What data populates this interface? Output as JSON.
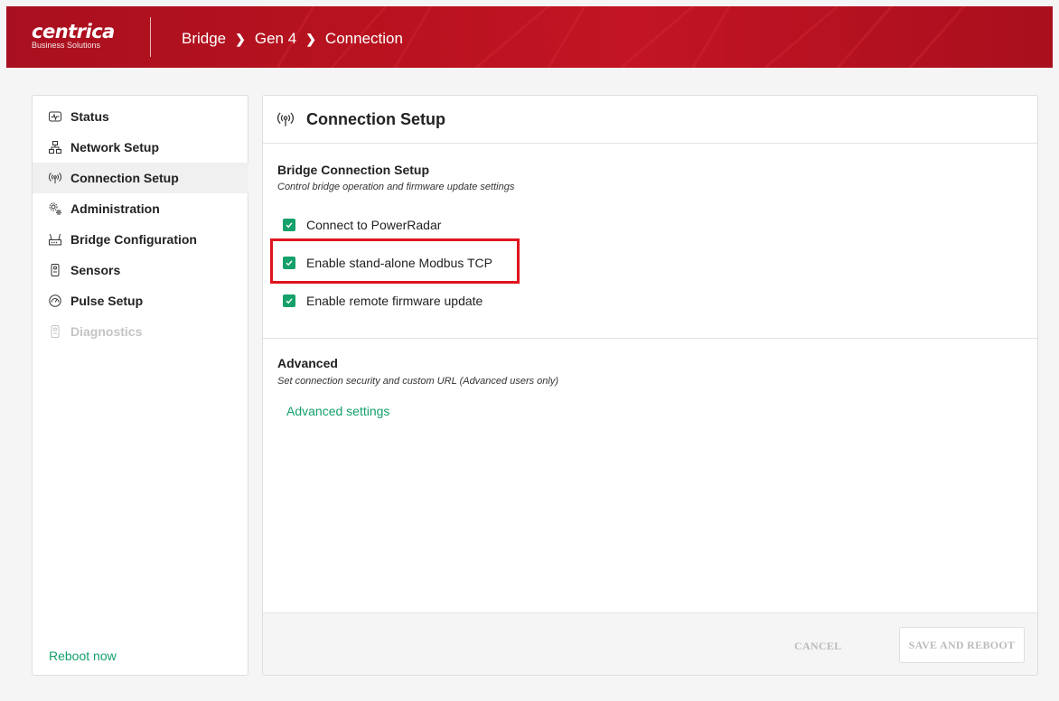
{
  "header": {
    "logo_text": "centrica",
    "logo_sub": "Business Solutions",
    "breadcrumb": [
      "Bridge",
      "Gen 4",
      "Connection"
    ],
    "breadcrumb_sep": "❯"
  },
  "sidebar": {
    "items": [
      {
        "label": "Status",
        "icon": "pulse-icon",
        "active": false,
        "disabled": false
      },
      {
        "label": "Network Setup",
        "icon": "network-icon",
        "active": false,
        "disabled": false
      },
      {
        "label": "Connection Setup",
        "icon": "antenna-icon",
        "active": true,
        "disabled": false
      },
      {
        "label": "Administration",
        "icon": "gears-icon",
        "active": false,
        "disabled": false
      },
      {
        "label": "Bridge Configuration",
        "icon": "router-icon",
        "active": false,
        "disabled": false
      },
      {
        "label": "Sensors",
        "icon": "sensor-icon",
        "active": false,
        "disabled": false
      },
      {
        "label": "Pulse Setup",
        "icon": "gauge-icon",
        "active": false,
        "disabled": false
      },
      {
        "label": "Diagnostics",
        "icon": "sensor-icon",
        "active": false,
        "disabled": true
      }
    ],
    "reboot_label": "Reboot now"
  },
  "panel": {
    "title": "Connection Setup",
    "bridge_section": {
      "title": "Bridge Connection Setup",
      "subtitle": "Control bridge operation and firmware update settings",
      "options": [
        {
          "label": "Connect to PowerRadar",
          "checked": true
        },
        {
          "label": "Enable stand-alone Modbus TCP",
          "checked": true
        },
        {
          "label": "Enable remote firmware update",
          "checked": true
        }
      ]
    },
    "advanced_section": {
      "title": "Advanced",
      "subtitle": "Set connection security and custom URL (Advanced users only)",
      "link_label": "Advanced settings"
    },
    "footer": {
      "cancel_label": "CANCEL",
      "save_label": "SAVE AND REBOOT"
    }
  },
  "colors": {
    "brand_red": "#b8121f",
    "accent_green": "#16a06a",
    "highlight_red": "#e0141e"
  }
}
